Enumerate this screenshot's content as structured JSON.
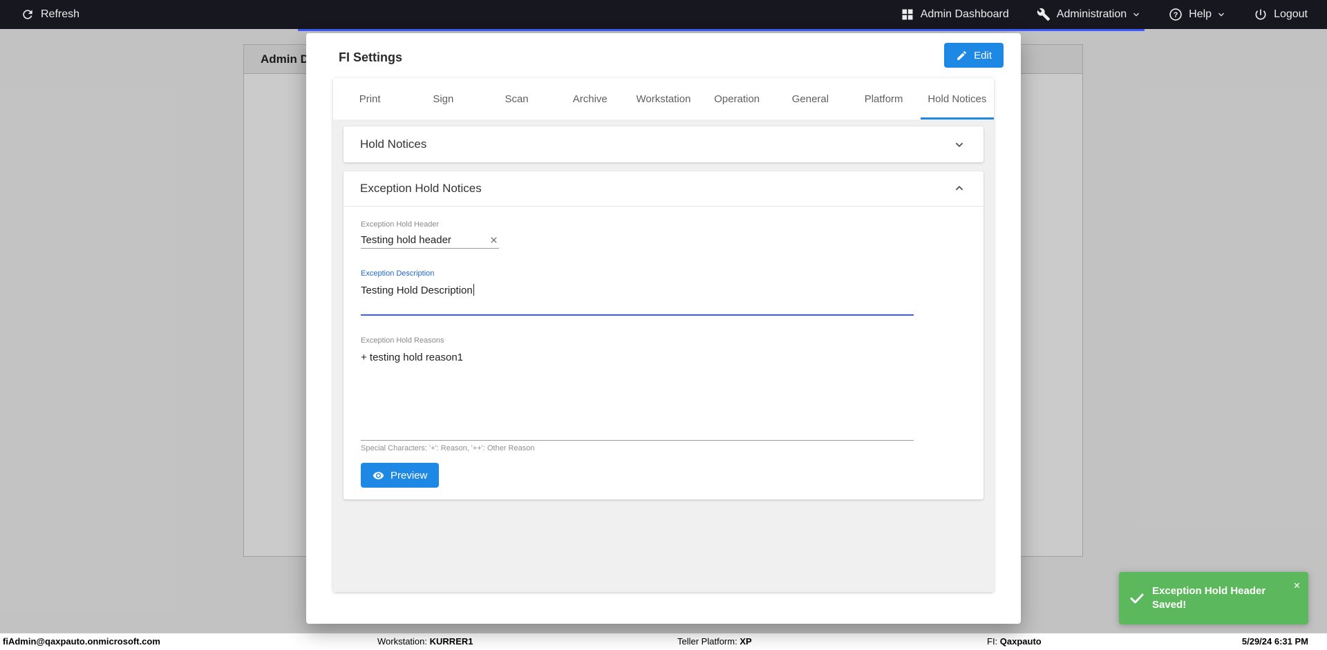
{
  "topbar": {
    "refresh": "Refresh",
    "admin_dashboard": "Admin Dashboard",
    "administration": "Administration",
    "help": "Help",
    "logout": "Logout"
  },
  "background": {
    "panel_title": "Admin D"
  },
  "modal": {
    "title": "FI Settings",
    "edit_button": "Edit",
    "tabs": [
      {
        "label": "Print"
      },
      {
        "label": "Sign"
      },
      {
        "label": "Scan"
      },
      {
        "label": "Archive"
      },
      {
        "label": "Workstation"
      },
      {
        "label": "Operation"
      },
      {
        "label": "General"
      },
      {
        "label": "Platform"
      },
      {
        "label": "Hold Notices",
        "active": true
      }
    ],
    "hold_notices_panel": {
      "title": "Hold Notices",
      "expanded": false
    },
    "exception_panel": {
      "title": "Exception Hold Notices",
      "expanded": true,
      "header_field": {
        "label": "Exception Hold Header",
        "value": "Testing hold header"
      },
      "description_field": {
        "label": "Exception Description",
        "value": "Testing Hold Description"
      },
      "reasons_field": {
        "label": "Exception Hold Reasons",
        "value": "+ testing hold reason1",
        "hint": "Special Characters: '+': Reason, '++': Other Reason"
      },
      "preview_button": "Preview"
    }
  },
  "toast": {
    "message": "Exception Hold Header Saved!"
  },
  "statusbar": {
    "user": "fiAdmin@qaxpauto.onmicrosoft.com",
    "workstation_label": "Workstation:",
    "workstation_value": "KURRER1",
    "teller_platform_label": "Teller Platform:",
    "teller_platform_value": "XP",
    "fi_label": "FI:",
    "fi_value": "Qaxpauto",
    "datetime": "5/29/24 6:31 PM"
  },
  "colors": {
    "accent_blue": "#1e88e5",
    "focused_underline_blue": "#3d5afe",
    "field_label_blue": "#1967d2",
    "toast_green": "#5cb85c",
    "topbar_bg": "#17171f"
  }
}
